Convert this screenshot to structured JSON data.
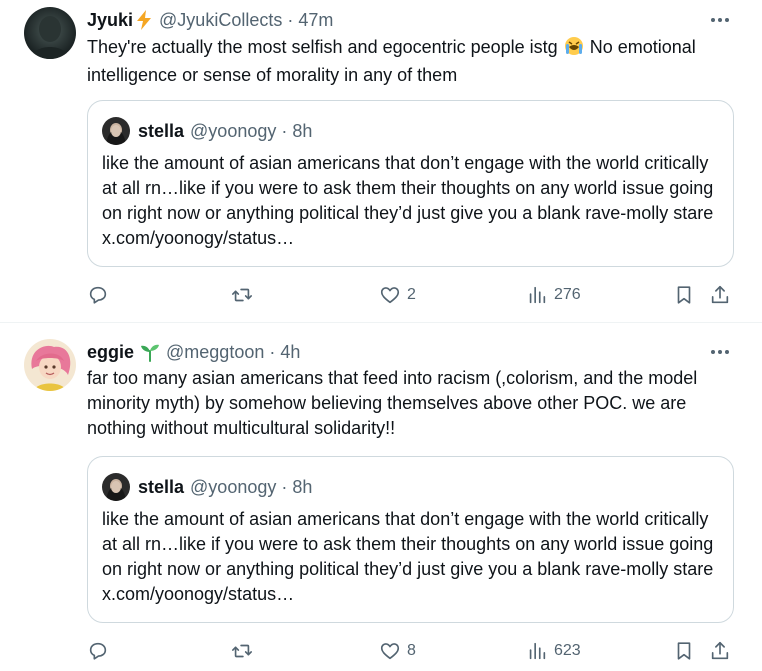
{
  "tweets": [
    {
      "author_name": "Jyuki",
      "author_emoji": "⚡",
      "handle": "@JyukiCollects",
      "separator": "·",
      "time": "47m",
      "text_before_emoji": "They're actually the most selfish and egocentric people istg ",
      "text_emoji": "😭",
      "text_after_emoji": " No emotional intelligence or sense of morality in any of them",
      "quote": {
        "author_name": "stella",
        "handle": "@yoonogy",
        "separator": "·",
        "time": "8h",
        "text": "like the amount of asian americans that don’t engage with the world critically at all rn…like if you were to ask them their thoughts on any world issue going on right now or anything political they’d just give you a blank rave-molly stare x.com/yoonogy/status…"
      },
      "stats": {
        "replies": "",
        "reposts": "",
        "likes": "2",
        "views": "276"
      }
    },
    {
      "author_name": "eggie",
      "author_emoji": "🌱",
      "handle": "@meggtoon",
      "separator": "·",
      "time": "4h",
      "text": "far too many asian americans that feed into racism (,colorism, and the model minority myth) by somehow believing themselves above other POC. we are nothing without multicultural solidarity!!",
      "quote": {
        "author_name": "stella",
        "handle": "@yoonogy",
        "separator": "·",
        "time": "8h",
        "text": "like the amount of asian americans that don’t engage with the world critically at all rn…like if you were to ask them their thoughts on any world issue going on right now or anything political they’d just give you a blank rave-molly stare x.com/yoonogy/status…"
      },
      "stats": {
        "replies": "",
        "reposts": "",
        "likes": "8",
        "views": "623"
      }
    }
  ],
  "icons": {
    "more": "more-horizontal-icon",
    "reply": "reply-icon",
    "repost": "repost-icon",
    "like": "heart-icon",
    "views": "views-bar-chart-icon",
    "bookmark": "bookmark-icon",
    "share": "share-icon"
  },
  "colors": {
    "text_primary": "#0f1419",
    "text_secondary": "#536471",
    "border": "#cfd9de",
    "divider": "#eff3f4",
    "lightning": "#f5a623",
    "sprout": "#3aa756"
  }
}
